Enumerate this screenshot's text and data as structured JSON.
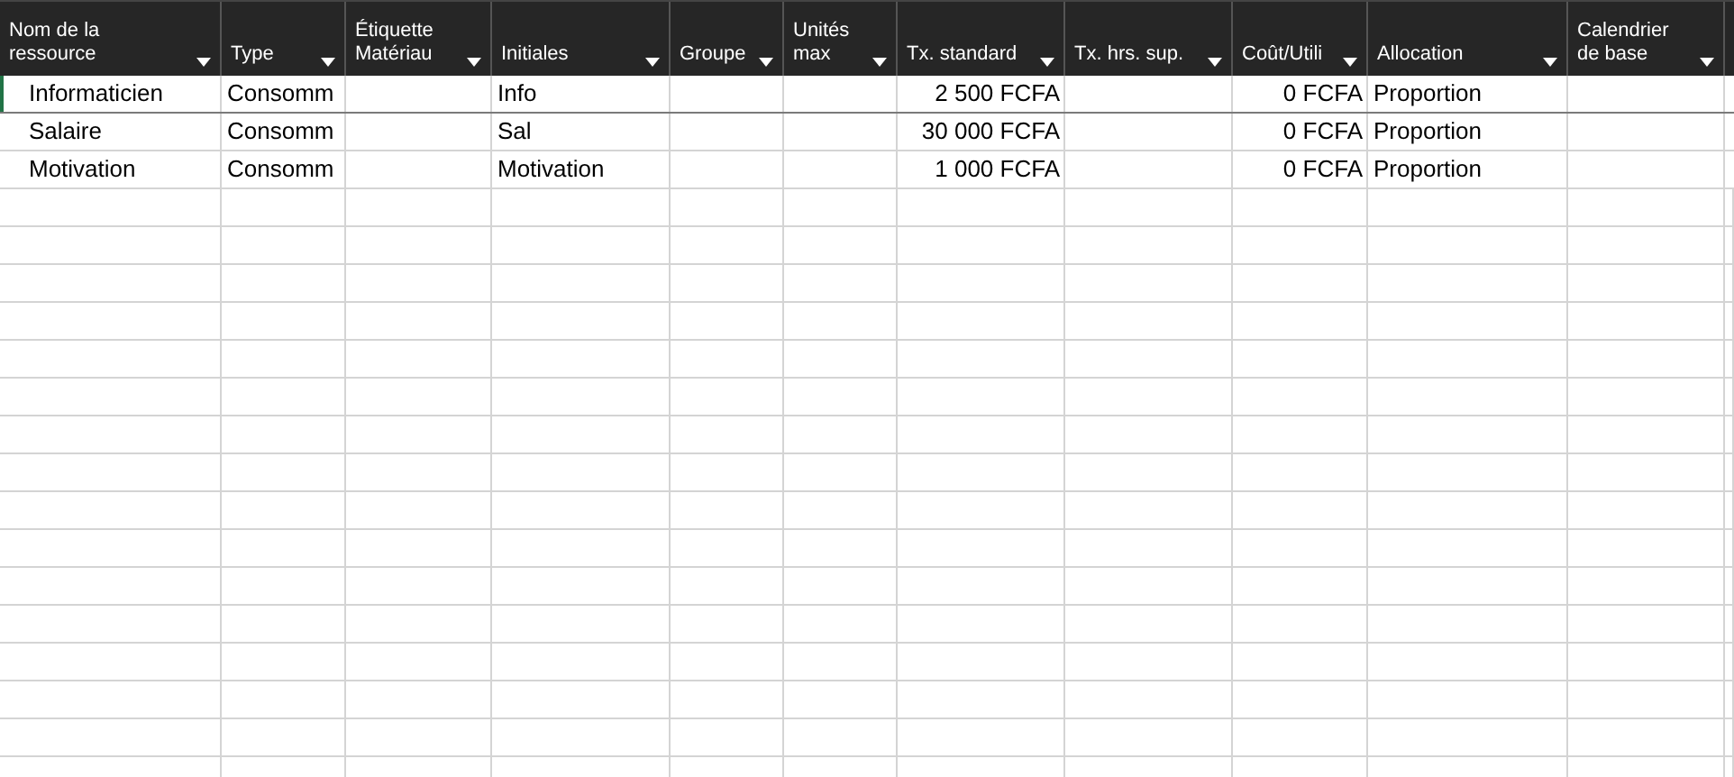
{
  "table": {
    "columns": [
      {
        "label": "Nom de la ressource"
      },
      {
        "label": "Type"
      },
      {
        "label": "Étiquette Matériau"
      },
      {
        "label": "Initiales"
      },
      {
        "label": "Groupe"
      },
      {
        "label": "Unités max"
      },
      {
        "label": "Tx. standard"
      },
      {
        "label": "Tx. hrs. sup."
      },
      {
        "label": "Coût/Utili"
      },
      {
        "label": "Allocation"
      },
      {
        "label": "Calendrier de base"
      }
    ],
    "rows": [
      {
        "selected": true,
        "cells": [
          "Informaticien",
          "Consomm",
          "",
          "Info",
          "",
          "",
          "2 500 FCFA",
          "",
          "0 FCFA",
          "Proportion",
          ""
        ]
      },
      {
        "selected": false,
        "cells": [
          "Salaire",
          "Consomm",
          "",
          "Sal",
          "",
          "",
          "30 000 FCFA",
          "",
          "0 FCFA",
          "Proportion",
          ""
        ]
      },
      {
        "selected": false,
        "cells": [
          "Motivation",
          "Consomm",
          "",
          "Motivation",
          "",
          "",
          "1 000 FCFA",
          "",
          "0 FCFA",
          "Proportion",
          ""
        ]
      }
    ]
  }
}
